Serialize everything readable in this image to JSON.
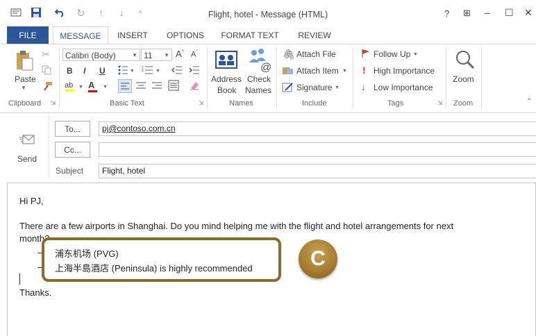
{
  "window": {
    "title": "Flight, hotel - Message (HTML)",
    "controls": {
      "help": "?",
      "restore_ribbon": "⊞",
      "minimize": "–",
      "maximize": "☐",
      "close": "✕"
    }
  },
  "tabs": [
    {
      "label": "FILE"
    },
    {
      "label": "MESSAGE"
    },
    {
      "label": "INSERT"
    },
    {
      "label": "OPTIONS"
    },
    {
      "label": "FORMAT TEXT"
    },
    {
      "label": "REVIEW"
    }
  ],
  "ribbon": {
    "clipboard": {
      "label": "Clipboard",
      "paste": "Paste"
    },
    "basic_text": {
      "label": "Basic Text",
      "font": "Calibri (Body)",
      "size": "11",
      "bold": "B",
      "italic": "I",
      "underline": "U"
    },
    "names": {
      "label": "Names",
      "address_book_l1": "Address",
      "address_book_l2": "Book",
      "check_names_l1": "Check",
      "check_names_l2": "Names"
    },
    "include": {
      "label": "Include",
      "attach_file": "Attach File",
      "attach_item": "Attach Item",
      "signature": "Signature"
    },
    "tags": {
      "label": "Tags",
      "follow_up": "Follow Up",
      "high": "High Importance",
      "low": "Low Importance"
    },
    "zoom": {
      "label": "Zoom",
      "zoom": "Zoom"
    }
  },
  "header": {
    "send": "Send",
    "to_button": "To...",
    "to_value": "pj@contoso.com.cn",
    "cc_button": "Cc...",
    "cc_value": "",
    "subject_label": "Subject",
    "subject_value": "Flight, hotel"
  },
  "body": {
    "greeting": "Hi PJ,",
    "line1": "There are a few airports in Shanghai. Do you mind helping me with the flight and hotel arrangements for next",
    "line2": "month?",
    "bullet1": "浦东机场 (PVG)",
    "bullet2": "上海半島酒店 (Peninsula) is highly recommended",
    "closing": "Thanks."
  },
  "callout": {
    "badge": "C",
    "color": "#8b6a2b"
  },
  "colors": {
    "accent": "#2b579a"
  }
}
